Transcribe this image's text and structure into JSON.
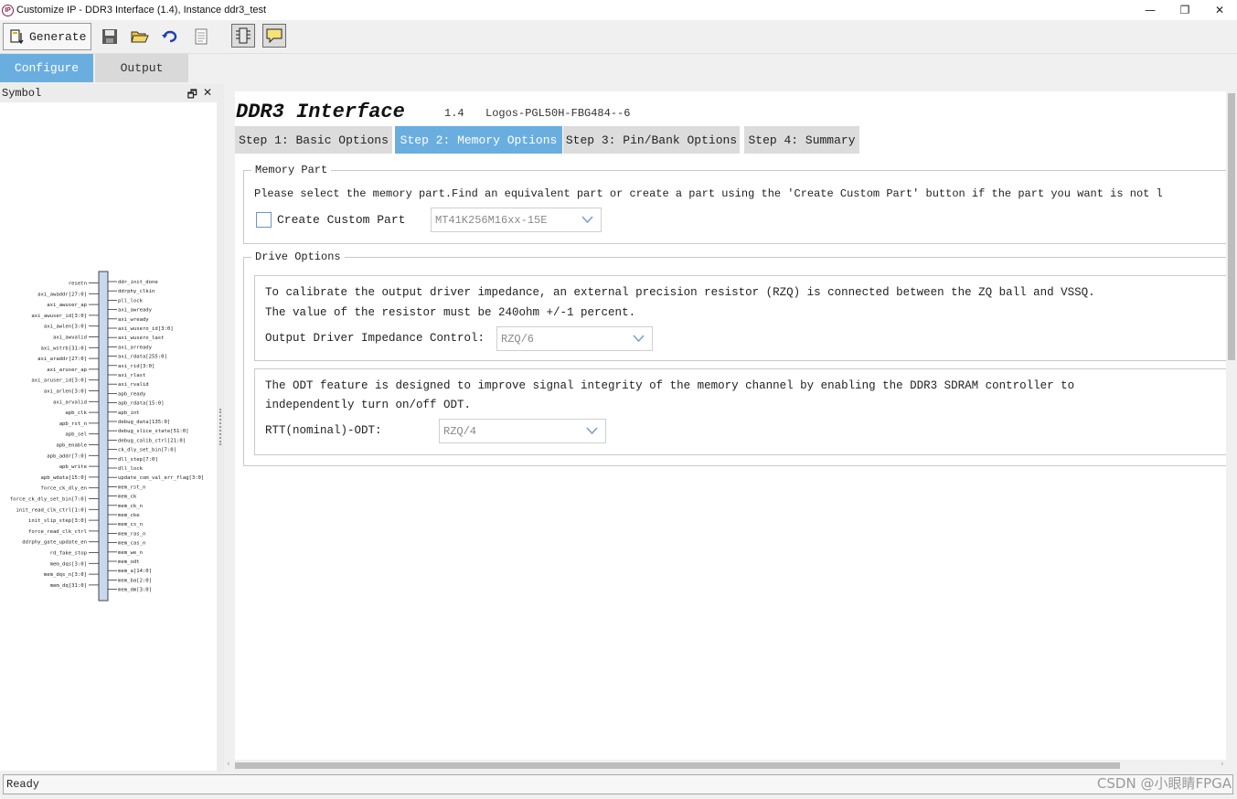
{
  "window": {
    "title": "Customize IP - DDR3 Interface (1.4), Instance ddr3_test",
    "app_icon_text": "IP",
    "minimize_glyph": "—",
    "restore_glyph": "❐",
    "close_glyph": "✕"
  },
  "toolbar": {
    "generate_label": "Generate",
    "icons": [
      "save-icon",
      "open-folder-icon",
      "refresh-icon",
      "document-icon",
      "symbol-view-icon",
      "message-icon"
    ]
  },
  "main_tabs": [
    {
      "label": "Configure",
      "active": true
    },
    {
      "label": "Output",
      "active": false
    }
  ],
  "symbol_panel": {
    "title": "Symbol",
    "float_glyph": "🗗",
    "close_glyph": "✕",
    "inputs": [
      "resetn",
      "axi_awaddr[27:0]",
      "axi_awuser_ap",
      "axi_awuser_id[3:0]",
      "axi_awlen[3:0]",
      "axi_awvalid",
      "axi_wstrb[31:0]",
      "axi_araddr[27:0]",
      "axi_aruser_ap",
      "axi_aruser_id[3:0]",
      "axi_arlen[3:0]",
      "axi_arvalid",
      "apb_clk",
      "apb_rst_n",
      "apb_sel",
      "apb_enable",
      "apb_addr[7:0]",
      "apb_write",
      "apb_wdata[15:0]",
      "force_ck_dly_en",
      "force_ck_dly_set_bin[7:0]",
      "init_read_clk_ctrl[1:0]",
      "init_slip_step[3:0]",
      "force_read_clk_ctrl",
      "ddrphy_gate_update_en",
      "rd_fake_stop",
      "mem_dqs[3:0]",
      "mem_dqs_n[3:0]",
      "mem_dq[31:0]"
    ],
    "outputs": [
      "ddr_init_done",
      "ddrphy_clkin",
      "pll_lock",
      "axi_awready",
      "axi_wready",
      "axi_wusero_id[3:0]",
      "axi_wusero_last",
      "axi_arready",
      "axi_rdata[255:0]",
      "axi_rid[3:0]",
      "axi_rlast",
      "axi_rvalid",
      "apb_ready",
      "apb_rdata[15:0]",
      "apb_int",
      "debug_data[135:0]",
      "debug_slice_state[51:0]",
      "debug_calib_ctrl[21:0]",
      "ck_dly_set_bin[7:0]",
      "dll_step[7:0]",
      "dll_lock",
      "update_com_val_err_flag[3:0]",
      "mem_rst_n",
      "mem_ck",
      "mem_ck_n",
      "mem_cke",
      "mem_cs_n",
      "mem_ras_n",
      "mem_cas_n",
      "mem_we_n",
      "mem_odt",
      "mem_a[14:0]",
      "mem_ba[2:0]",
      "mem_dm[3:0]"
    ]
  },
  "ip": {
    "name": "DDR3 Interface",
    "version": "1.4",
    "device": "Logos-PGL50H-FBG484--6"
  },
  "steps": [
    {
      "label": "Step 1: Basic Options",
      "active": false
    },
    {
      "label": "Step 2: Memory Options",
      "active": true
    },
    {
      "label": "Step 3: Pin/Bank Options",
      "active": false
    },
    {
      "label": "Step 4: Summary",
      "active": false
    }
  ],
  "memory_part": {
    "title": "Memory Part",
    "description": "Please select the memory part.Find an equivalent part or create a part using the 'Create Custom Part' button if the part you want is not l",
    "custom_part_label": "Create Custom Part",
    "custom_part_checked": false,
    "part_value": "MT41K256M16xx-15E"
  },
  "drive_options": {
    "title": "Drive Options",
    "impedance_text_1": "To calibrate the output driver impedance, an external precision resistor (RZQ) is connected between the ZQ ball and VSSQ.",
    "impedance_text_2": "The value of the resistor must be 240ohm +/-1 percent.",
    "impedance_label": "Output Driver Impedance Control:",
    "impedance_value": "RZQ/6",
    "odt_text_1": "The ODT feature is designed to improve signal integrity of the memory channel by enabling the DDR3 SDRAM controller to",
    "odt_text_2": "independently turn on/off ODT.",
    "odt_label": "RTT(nominal)-ODT:",
    "odt_value": "RZQ/4"
  },
  "status": {
    "text": "Ready",
    "watermark": "CSDN @小眼睛FPGA"
  },
  "colors": {
    "accent": "#6aaee0",
    "inactive_tab": "#dcdcdc"
  }
}
